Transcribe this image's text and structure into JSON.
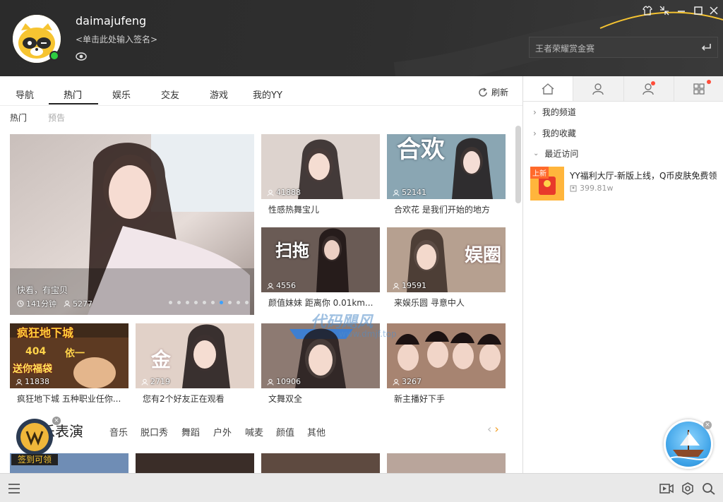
{
  "header": {
    "username": "daimajufeng",
    "signature_placeholder": "<单击此处输入签名>",
    "search_placeholder": "王者荣耀赏金赛",
    "accent_color": "#f6c431"
  },
  "tabs": [
    {
      "label": "导航"
    },
    {
      "label": "热门",
      "active": true
    },
    {
      "label": "娱乐"
    },
    {
      "label": "交友"
    },
    {
      "label": "游戏"
    },
    {
      "label": "我的YY"
    }
  ],
  "refresh_label": "刷新",
  "subtabs": [
    {
      "label": "热门"
    },
    {
      "label": "预告"
    }
  ],
  "banner": {
    "caption": "快看，有宝贝",
    "duration": "141分钟",
    "viewers": "5277",
    "slide_count": 10,
    "active_slide": 7
  },
  "cards": [
    {
      "viewers": "41888",
      "title": "性感热舞宝儿",
      "color": "#cfc3bd"
    },
    {
      "viewers": "52141",
      "title": "合欢花 是我们开始的地方",
      "color": "#7d9bab"
    },
    {
      "viewers": "4556",
      "title": "颜值妹妹 距离你 0.01km...",
      "color": "#6a5b55"
    },
    {
      "viewers": "19591",
      "title": "来娱乐圆 寻意中人",
      "color": "#b29989"
    },
    {
      "viewers": "11838",
      "title": "疯狂地下城 五种职业任你...",
      "color": "#6b3f2a"
    },
    {
      "viewers": "2719",
      "title": "您有2个好友正在观看",
      "color": "#d8c6bd"
    },
    {
      "viewers": "10906",
      "title": "文舞双全",
      "color": "#8d7a72"
    },
    {
      "viewers": "3267",
      "title": "新主播好下手",
      "color": "#a78471"
    }
  ],
  "overlay_texts": {
    "card1_big": "合欢",
    "card2_big": "扫拖",
    "card3_big": "娱圈",
    "card4_top": "疯狂地下城",
    "card4_mid": "404",
    "card4_mid2": "依一",
    "card4_bottom": "送你福袋",
    "card5_big": "金"
  },
  "section": {
    "title": "乐表演",
    "tags": [
      "音乐",
      "脱口秀",
      "舞蹈",
      "户外",
      "喊麦",
      "颜值",
      "其他"
    ]
  },
  "checkin_label": "签到可领",
  "side": {
    "rows": [
      {
        "label": "我的频道",
        "expanded": false
      },
      {
        "label": "我的收藏",
        "expanded": false
      },
      {
        "label": "最近访问",
        "expanded": true
      }
    ],
    "recent": {
      "tag": "上新",
      "title": "YY福利大厅-新版上线，Q币皮肤免费领",
      "meta": "399.81w"
    }
  },
  "watermark": {
    "text": "代码飓风",
    "url": "www.dmjf.top"
  }
}
